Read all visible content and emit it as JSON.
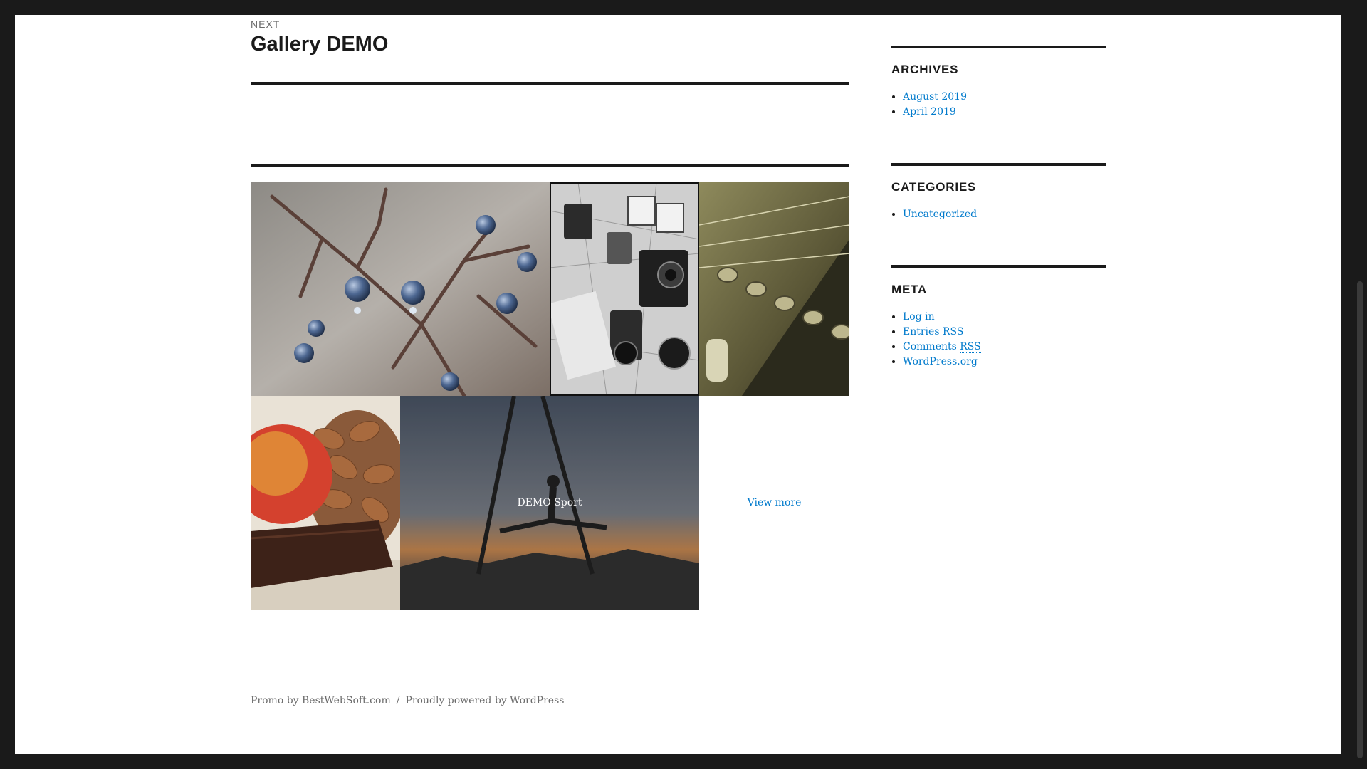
{
  "post_nav": {
    "label": "NEXT",
    "title": "Gallery DEMO"
  },
  "gallery": {
    "sport_caption": "DEMO Sport",
    "view_more": "View more",
    "images": [
      {
        "name": "sloe-berries-icon",
        "subject": "berries on branch"
      },
      {
        "name": "camera-map-icon",
        "subject": "cameras on map"
      },
      {
        "name": "guitar-headstock-icon",
        "subject": "guitar headstock"
      },
      {
        "name": "apple-almonds-icon",
        "subject": "apple almonds chocolate"
      },
      {
        "name": "aerial-silk-icon",
        "subject": "aerial silk sunset"
      }
    ]
  },
  "sidebar": {
    "archives": {
      "title": "ARCHIVES",
      "items": [
        "August 2019",
        "April 2019"
      ]
    },
    "categories": {
      "title": "CATEGORIES",
      "items": [
        "Uncategorized"
      ]
    },
    "meta": {
      "title": "META",
      "items": {
        "login": "Log in",
        "entries_prefix": "Entries",
        "comments_prefix": "Comments",
        "rss": "RSS",
        "wporg": "WordPress.org"
      }
    }
  },
  "footer": {
    "promo": "Promo by BestWebSoft.com",
    "separator": "/",
    "powered": "Proudly powered by WordPress"
  },
  "colors": {
    "link": "#007acc",
    "frame": "#1a1a1a",
    "muted": "#6b6b6b"
  }
}
